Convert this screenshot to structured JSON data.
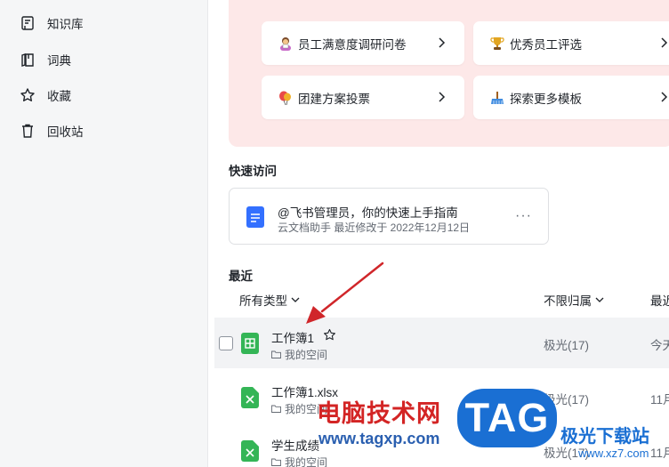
{
  "sidebar": {
    "items": [
      {
        "label": "知识库",
        "icon": "knowledge-base-icon"
      },
      {
        "label": "词典",
        "icon": "dictionary-icon"
      },
      {
        "label": "收藏",
        "icon": "star-icon"
      },
      {
        "label": "回收站",
        "icon": "trash-icon"
      }
    ]
  },
  "templates": [
    {
      "label": "员工满意度调研问卷",
      "icon": "survey-person-emoji"
    },
    {
      "label": "优秀员工评选",
      "icon": "trophy-emoji"
    },
    {
      "label": "团建方案投票",
      "icon": "balloon-emoji"
    },
    {
      "label": "探索更多模板",
      "icon": "broom-emoji"
    }
  ],
  "quick_access": {
    "title": "快速访问",
    "card": {
      "title": "@飞书管理员，你的快速上手指南",
      "subtitle": "云文档助手 最近修改于 2022年12月12日",
      "more": "···"
    }
  },
  "recent": {
    "title": "最近",
    "filters": {
      "type": "所有类型",
      "owner": "不限归属",
      "time": "最近"
    },
    "rows": [
      {
        "name": "工作簿1",
        "location": "我的空间",
        "owner": "极光(17)",
        "time": "今天",
        "icon": "sheet-icon",
        "starred": false
      },
      {
        "name": "工作簿1.xlsx",
        "location": "我的空间",
        "owner": "极光(17)",
        "time": "11月",
        "icon": "excel-icon"
      },
      {
        "name": "学生成绩",
        "location": "我的空间",
        "owner": "极光(17)",
        "time": "11月",
        "icon": "excel-icon"
      }
    ]
  },
  "watermark": {
    "cn": "电脑技术网",
    "url": "www.tagxp.com",
    "tag": "TAG",
    "site": "极光下载站",
    "site_url": "www.xz7.com"
  },
  "colors": {
    "accent_red_panel": "#fde8e8",
    "sheet_green": "#34b556",
    "doc_blue": "#3370ff",
    "arrow_red": "#d0262a"
  }
}
